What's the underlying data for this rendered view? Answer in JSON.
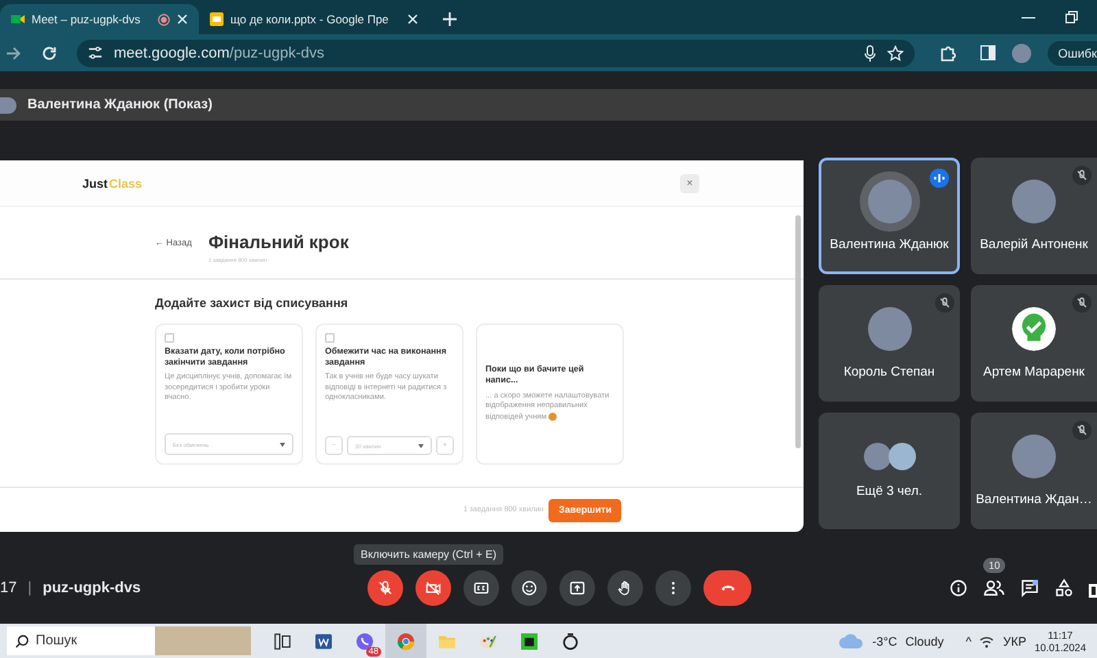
{
  "browser": {
    "tabs": [
      {
        "title": "Meet – puz-ugpk-dvs",
        "kind": "meet",
        "recording": true,
        "selected": true
      },
      {
        "title": "що де коли.pptx - Google Пре",
        "kind": "slides",
        "recording": false,
        "selected": false
      }
    ],
    "url_host": "meet.google.com",
    "url_path": "/puz-ugpk-dvs",
    "profile_button": "Ошибк"
  },
  "presenter_bar": {
    "title": "Валентина Жданюк (Показ)"
  },
  "presentation": {
    "logo_part_1": "Just",
    "logo_part_2": "Class",
    "close": "×",
    "back": "← Назад",
    "title": "Фінальний крок",
    "subtitle": "1 завдання 800 хвилин",
    "section_title": "Додайте захист від списування",
    "cards": [
      {
        "kind": "select",
        "checked": false,
        "title": "Вказати дату, коли потрібно закінчити завдання",
        "text": "Це дисциплінує учнів, допомагає їм зосередитися і зробити уроки вчасно.",
        "placeholder": "Без обмежень"
      },
      {
        "kind": "stepper",
        "checked": false,
        "title": "Обмежити час на виконання завдання",
        "text": "Так в учнів не буде часу шукати відповіді в інтернеті чи радитися з однокласниками.",
        "minus": "−",
        "value": "30 хвилин",
        "plus": "+"
      },
      {
        "kind": "info",
        "title": "Поки що ви бачите цей напис...",
        "text": "... а скоро зможете налаштовувати відображення неправильних відповідей учням"
      }
    ],
    "footer_summary": "1 завдання 800 хвилин",
    "finish_button": "Завершити"
  },
  "participants": [
    {
      "name": "Валентина Жданюк",
      "kind": "photo",
      "muted": false,
      "speaking": true,
      "selected": true
    },
    {
      "name": "Валерій Антоненк",
      "kind": "photo",
      "muted": true,
      "speaking": false,
      "selected": false
    },
    {
      "name": "Король Степан",
      "kind": "photo",
      "muted": true,
      "speaking": false,
      "selected": false
    },
    {
      "name": "Артем Мараренк",
      "kind": "check",
      "muted": true,
      "speaking": false,
      "selected": false
    },
    {
      "name": "Ещё 3 чел.",
      "kind": "stack",
      "muted": false,
      "speaking": false,
      "selected": false
    },
    {
      "name": "Валентина Ждан…",
      "kind": "photo",
      "muted": true,
      "speaking": false,
      "selected": false
    }
  ],
  "meeting_bar": {
    "time": "17",
    "separator": "|",
    "code": "puz-ugpk-dvs",
    "tooltip": "Включить камеру (Ctrl + E)",
    "controls": [
      {
        "kind": "mic",
        "off": true
      },
      {
        "kind": "camera",
        "off": true
      },
      {
        "kind": "captions",
        "off": false
      },
      {
        "kind": "emoji",
        "off": false
      },
      {
        "kind": "present",
        "off": false
      },
      {
        "kind": "hand",
        "off": false
      },
      {
        "kind": "more",
        "off": false
      },
      {
        "kind": "end",
        "off": true
      }
    ],
    "people_count": "10"
  },
  "taskbar": {
    "search_placeholder": "Пошук",
    "apps": [
      {
        "kind": "taskview",
        "active": false
      },
      {
        "kind": "word",
        "active": false
      },
      {
        "kind": "viber",
        "active": false,
        "badge": "48"
      },
      {
        "kind": "chrome",
        "active": true
      },
      {
        "kind": "files",
        "active": false
      },
      {
        "kind": "paint",
        "active": false
      },
      {
        "kind": "game",
        "active": false
      },
      {
        "kind": "ring",
        "active": false
      }
    ],
    "temperature": "-3°C",
    "weather": "Cloudy",
    "caret": "^",
    "language": "УКР",
    "time": "11:17",
    "date": "10.01.2024"
  }
}
